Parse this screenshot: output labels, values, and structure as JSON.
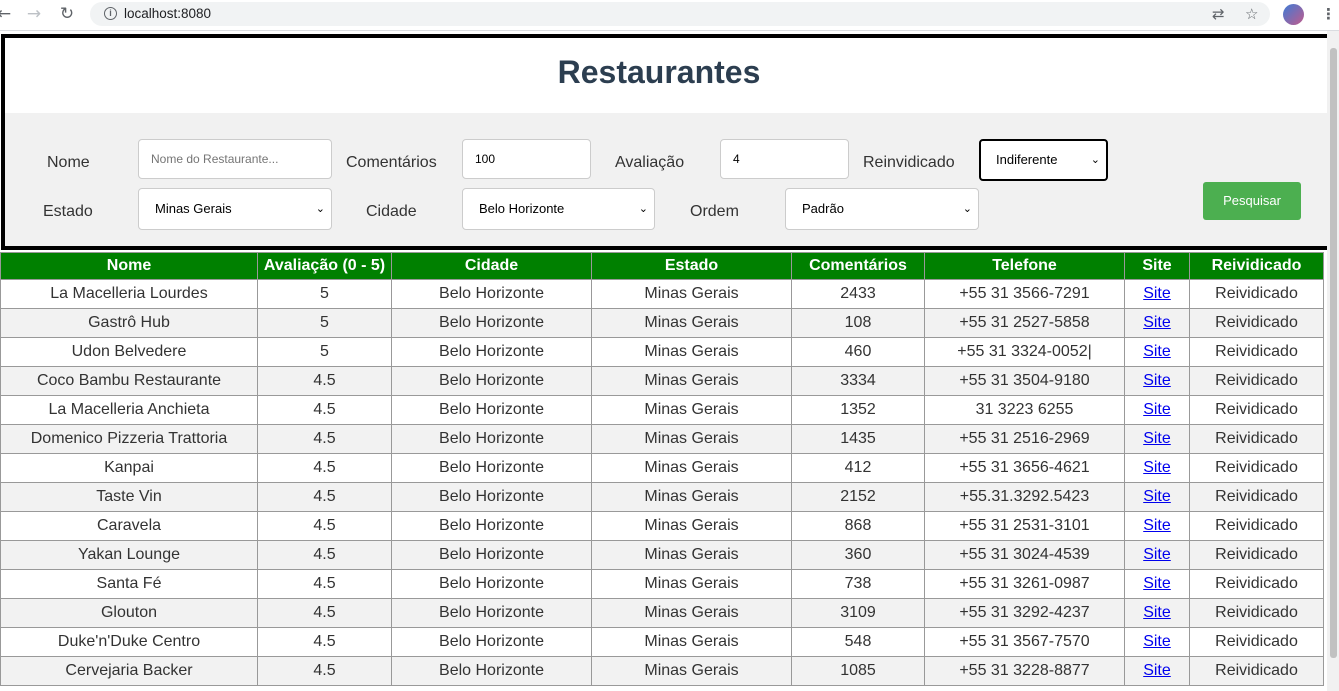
{
  "browser": {
    "url": "localhost:8080"
  },
  "page": {
    "title": "Restaurantes"
  },
  "form": {
    "nome_label": "Nome",
    "nome_placeholder": "Nome do Restaurante...",
    "comentarios_label": "Comentários",
    "comentarios_value": "100",
    "avaliacao_label": "Avaliação",
    "avaliacao_value": "4",
    "reivindicado_label": "Reinvidicado",
    "reivindicado_value": "Indiferente",
    "estado_label": "Estado",
    "estado_value": "Minas Gerais",
    "cidade_label": "Cidade",
    "cidade_value": "Belo Horizonte",
    "ordem_label": "Ordem",
    "ordem_value": "Padrão",
    "search_button": "Pesquisar"
  },
  "table": {
    "headers": [
      "Nome",
      "Avaliação (0 - 5)",
      "Cidade",
      "Estado",
      "Comentários",
      "Telefone",
      "Site",
      "Reividicado"
    ],
    "rows": [
      [
        "La Macelleria Lourdes",
        "5",
        "Belo Horizonte",
        "Minas Gerais",
        "2433",
        "+55 31 3566-7291",
        "Site",
        "Reividicado"
      ],
      [
        "Gastrô Hub",
        "5",
        "Belo Horizonte",
        "Minas Gerais",
        "108",
        "+55 31 2527-5858",
        "Site",
        "Reividicado"
      ],
      [
        "Udon Belvedere",
        "5",
        "Belo Horizonte",
        "Minas Gerais",
        "460",
        "+55 31 3324-0052|",
        "Site",
        "Reividicado"
      ],
      [
        "Coco Bambu Restaurante",
        "4.5",
        "Belo Horizonte",
        "Minas Gerais",
        "3334",
        "+55 31 3504-9180",
        "Site",
        "Reividicado"
      ],
      [
        "La Macelleria Anchieta",
        "4.5",
        "Belo Horizonte",
        "Minas Gerais",
        "1352",
        "31 3223 6255",
        "Site",
        "Reividicado"
      ],
      [
        "Domenico Pizzeria Trattoria",
        "4.5",
        "Belo Horizonte",
        "Minas Gerais",
        "1435",
        "+55 31 2516-2969",
        "Site",
        "Reividicado"
      ],
      [
        "Kanpai",
        "4.5",
        "Belo Horizonte",
        "Minas Gerais",
        "412",
        "+55 31 3656-4621",
        "Site",
        "Reividicado"
      ],
      [
        "Taste Vin",
        "4.5",
        "Belo Horizonte",
        "Minas Gerais",
        "2152",
        "+55.31.3292.5423",
        "Site",
        "Reividicado"
      ],
      [
        "Caravela",
        "4.5",
        "Belo Horizonte",
        "Minas Gerais",
        "868",
        "+55 31 2531-3101",
        "Site",
        "Reividicado"
      ],
      [
        "Yakan Lounge",
        "4.5",
        "Belo Horizonte",
        "Minas Gerais",
        "360",
        "+55 31 3024-4539",
        "Site",
        "Reividicado"
      ],
      [
        "Santa Fé",
        "4.5",
        "Belo Horizonte",
        "Minas Gerais",
        "738",
        "+55 31 3261-0987",
        "Site",
        "Reividicado"
      ],
      [
        "Glouton",
        "4.5",
        "Belo Horizonte",
        "Minas Gerais",
        "3109",
        "+55 31 3292-4237",
        "Site",
        "Reividicado"
      ],
      [
        "Duke'n'Duke Centro",
        "4.5",
        "Belo Horizonte",
        "Minas Gerais",
        "548",
        "+55 31 3567-7570",
        "Site",
        "Reividicado"
      ],
      [
        "Cervejaria Backer",
        "4.5",
        "Belo Horizonte",
        "Minas Gerais",
        "1085",
        "+55 31 3228-8877",
        "Site",
        "Reividicado"
      ]
    ]
  },
  "colors": {
    "header_green": "#008000",
    "button_green": "#4caf50",
    "title_color": "#2c3e50"
  }
}
